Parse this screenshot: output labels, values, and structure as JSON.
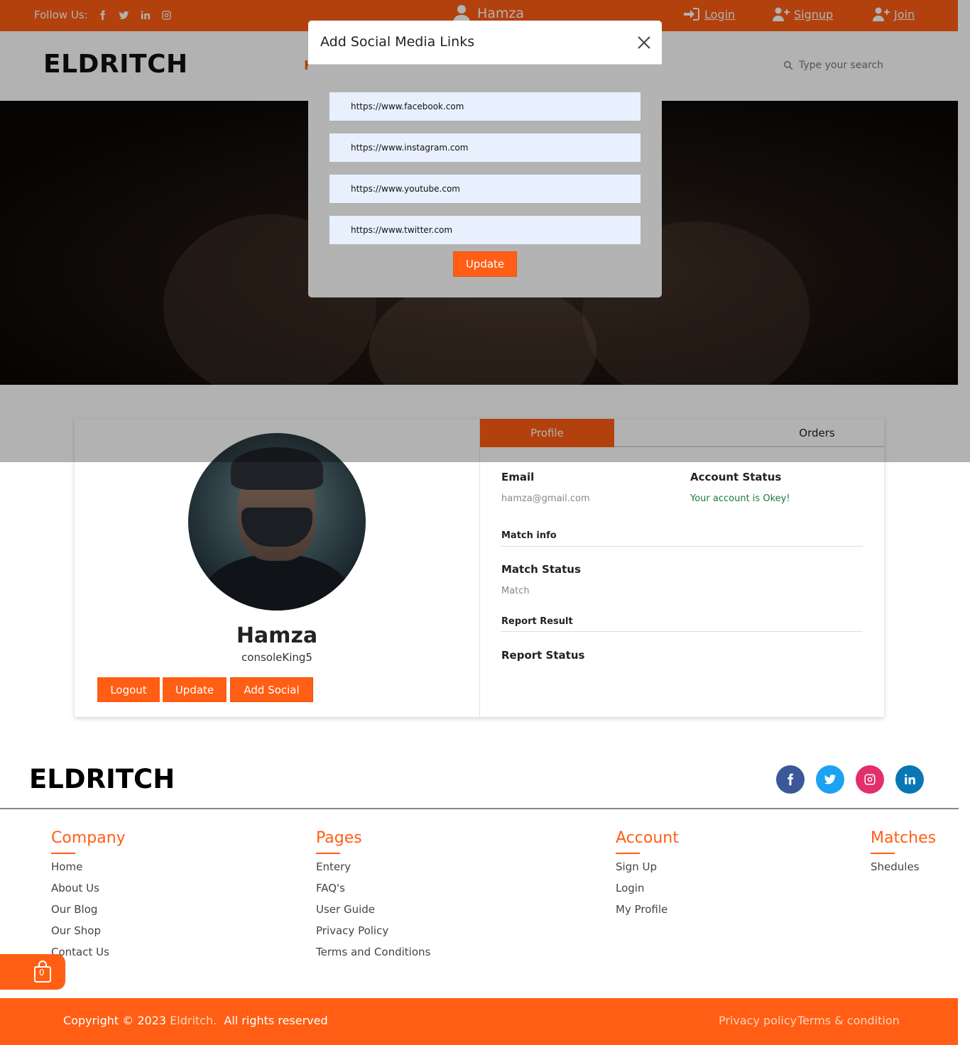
{
  "topbar": {
    "follow_label": "Follow Us:",
    "social_icons": [
      "facebook-icon",
      "twitter-icon",
      "linkedin-icon",
      "instagram-icon"
    ],
    "user_name": "Hamza",
    "login": "Login",
    "signup": "Signup",
    "join": "Join"
  },
  "header": {
    "logo": "ELDRITCH",
    "nav_hint": "H",
    "search_placeholder": "Type your search"
  },
  "profile": {
    "name": "Hamza",
    "username": "consoleKing5",
    "buttons": {
      "logout": "Logout",
      "update": "Update",
      "add_social": "Add Social"
    },
    "tabs": {
      "profile": "Profile",
      "orders": "Orders"
    },
    "email_label": "Email",
    "email_value": "hamza@gmail.com",
    "account_status_label": "Account Status",
    "account_status_value": "Your account is Okey!",
    "match_info": "Match info",
    "match_status_label": "Match Status",
    "match_status_value": "Match",
    "report_result": "Report Result",
    "report_status_label": "Report Status"
  },
  "modal": {
    "title": "Add Social Media Links",
    "facebook": "https://www.facebook.com",
    "instagram": "https://www.instagram.com",
    "youtube": "https://www.youtube.com",
    "twitter": "https://www.twitter.com",
    "update": "Update"
  },
  "footer": {
    "logo": "ELDRITCH",
    "social": [
      {
        "icon": "facebook-icon",
        "color": "#3b5998"
      },
      {
        "icon": "twitter-icon",
        "color": "#1da1f2"
      },
      {
        "icon": "instagram-icon",
        "color": "#e1306c"
      },
      {
        "icon": "linkedin-icon",
        "color": "#0a77b5"
      }
    ],
    "company": {
      "title": "Company",
      "links": [
        "Home",
        "About Us",
        "Our Blog",
        "Our Shop",
        "Contact Us"
      ]
    },
    "pages": {
      "title": "Pages",
      "links": [
        "Entery",
        "FAQ's",
        "User Guide",
        "Privacy Policy",
        "Terms and Conditions"
      ]
    },
    "account": {
      "title": "Account",
      "links": [
        "Sign Up",
        "Login",
        "My Profile"
      ]
    },
    "matches": {
      "title": "Matches",
      "links": [
        "Shedules"
      ]
    },
    "cart_count": "0",
    "copyright_prefix": "Copyright © 2023",
    "copyright_brand": "Eldritch.",
    "copyright_suffix": "All rights reserved",
    "privacy": "Privacy policy",
    "terms": "Terms & condition"
  },
  "colors": {
    "accent": "#ff5e14",
    "ok": "#1a7a42"
  }
}
